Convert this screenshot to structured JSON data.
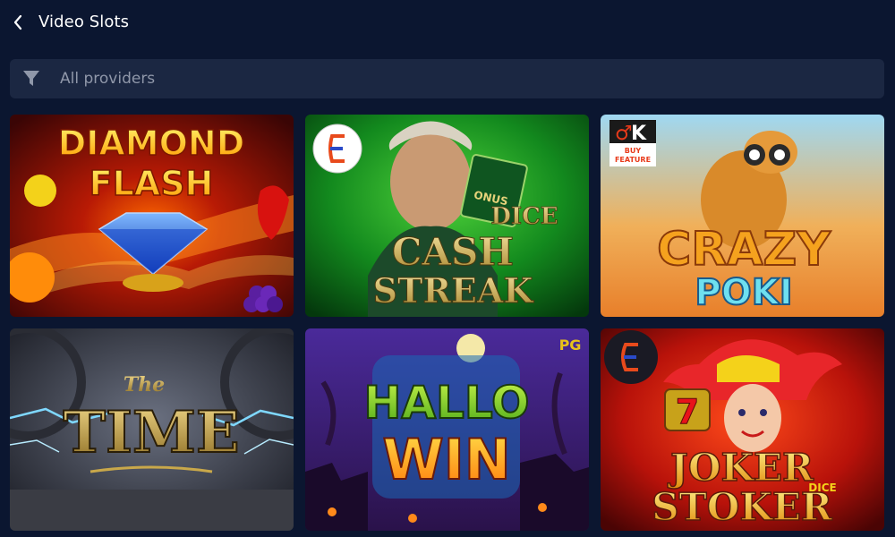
{
  "header": {
    "title": "Video Slots"
  },
  "filter": {
    "label": "All providers"
  },
  "games": [
    {
      "title_line1": "DIAMOND",
      "title_line2": "FLASH"
    },
    {
      "title_line1": "DICE",
      "title_line2": "CASH",
      "title_line3": "STREAK",
      "card_text": "ONUS"
    },
    {
      "badge": "K",
      "badge_caption_line1": "BUY",
      "badge_caption_line2": "FEATURE",
      "title_line1": "CRAZY",
      "title_line2": "POKI"
    },
    {
      "title_small": "The",
      "title_line1": "TIME"
    },
    {
      "title_line1": "HALLO",
      "title_line2": "WIN",
      "provider_badge": "PG"
    },
    {
      "title_line1": "JOKER",
      "title_line2": "STOKER",
      "title_extra": "DICE",
      "symbol": "7"
    }
  ]
}
